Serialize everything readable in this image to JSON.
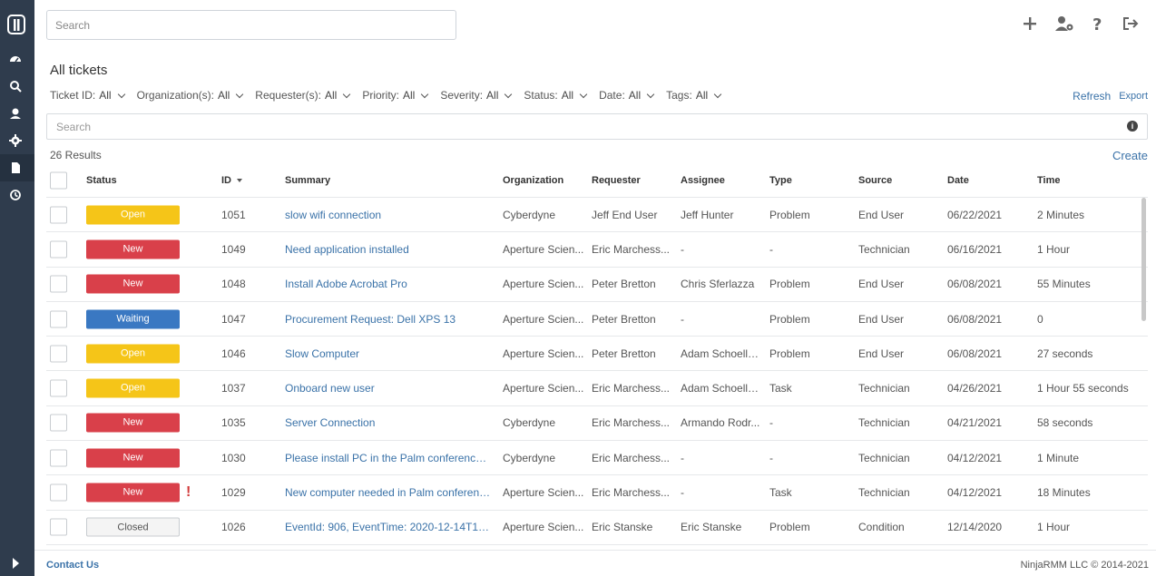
{
  "search": {
    "placeholder": "Search"
  },
  "page": {
    "title": "All tickets"
  },
  "filters": [
    {
      "label": "Ticket ID:",
      "value": "All"
    },
    {
      "label": "Organization(s):",
      "value": "All"
    },
    {
      "label": "Requester(s):",
      "value": "All"
    },
    {
      "label": "Priority:",
      "value": "All"
    },
    {
      "label": "Severity:",
      "value": "All"
    },
    {
      "label": "Status:",
      "value": "All"
    },
    {
      "label": "Date:",
      "value": "All"
    },
    {
      "label": "Tags:",
      "value": "All"
    }
  ],
  "actions": {
    "refresh": "Refresh",
    "export": "Export",
    "create": "Create"
  },
  "filter_search": {
    "placeholder": "Search"
  },
  "results_count": "26 Results",
  "columns": {
    "status": "Status",
    "id": "ID",
    "summary": "Summary",
    "organization": "Organization",
    "requester": "Requester",
    "assignee": "Assignee",
    "type": "Type",
    "source": "Source",
    "date": "Date",
    "time": "Time"
  },
  "status_colors": {
    "Open": "#f5c518",
    "New": "#d9404a",
    "Waiting": "#3a78c2",
    "Closed": "#f4f4f4"
  },
  "tickets": [
    {
      "status": "Open",
      "id": "1051",
      "summary": "slow wifi connection",
      "organization": "Cyberdyne",
      "requester": "Jeff End User",
      "assignee": "Jeff Hunter",
      "type": "Problem",
      "source": "End User",
      "date": "06/22/2021",
      "time": "2 Minutes",
      "alert": ""
    },
    {
      "status": "New",
      "id": "1049",
      "summary": "Need application installed",
      "organization": "Aperture Scien...",
      "requester": "Eric Marchess...",
      "assignee": "-",
      "type": "-",
      "source": "Technician",
      "date": "06/16/2021",
      "time": "1 Hour",
      "alert": ""
    },
    {
      "status": "New",
      "id": "1048",
      "summary": "Install Adobe Acrobat Pro",
      "organization": "Aperture Scien...",
      "requester": "Peter Bretton",
      "assignee": "Chris Sferlazza",
      "type": "Problem",
      "source": "End User",
      "date": "06/08/2021",
      "time": "55 Minutes",
      "alert": ""
    },
    {
      "status": "Waiting",
      "id": "1047",
      "summary": "Procurement Request: Dell XPS 13",
      "organization": "Aperture Scien...",
      "requester": "Peter Bretton",
      "assignee": "-",
      "type": "Problem",
      "source": "End User",
      "date": "06/08/2021",
      "time": "0",
      "alert": ""
    },
    {
      "status": "Open",
      "id": "1046",
      "summary": "Slow Computer",
      "organization": "Aperture Scien...",
      "requester": "Peter Bretton",
      "assignee": "Adam Schoelln...",
      "type": "Problem",
      "source": "End User",
      "date": "06/08/2021",
      "time": "27 seconds",
      "alert": ""
    },
    {
      "status": "Open",
      "id": "1037",
      "summary": "Onboard new user",
      "organization": "Aperture Scien...",
      "requester": "Eric Marchess...",
      "assignee": "Adam Schoelln...",
      "type": "Task",
      "source": "Technician",
      "date": "04/26/2021",
      "time": "1 Hour 55 seconds",
      "alert": ""
    },
    {
      "status": "New",
      "id": "1035",
      "summary": "Server Connection",
      "organization": "Cyberdyne",
      "requester": "Eric Marchess...",
      "assignee": "Armando Rodr...",
      "type": "-",
      "source": "Technician",
      "date": "04/21/2021",
      "time": "58 seconds",
      "alert": ""
    },
    {
      "status": "New",
      "id": "1030",
      "summary": "Please install PC in the Palm conference r...",
      "organization": "Cyberdyne",
      "requester": "Eric Marchess...",
      "assignee": "-",
      "type": "-",
      "source": "Technician",
      "date": "04/12/2021",
      "time": "1 Minute",
      "alert": ""
    },
    {
      "status": "New",
      "id": "1029",
      "summary": "New computer needed in Palm conferenc...",
      "organization": "Aperture Scien...",
      "requester": "Eric Marchess...",
      "assignee": "-",
      "type": "Task",
      "source": "Technician",
      "date": "04/12/2021",
      "time": "18 Minutes",
      "alert": "!"
    },
    {
      "status": "Closed",
      "id": "1026",
      "summary": "EventId: 906, EventTime: 2020-12-14T19:0...",
      "organization": "Aperture Scien...",
      "requester": "Eric Stanske",
      "assignee": "Eric Stanske",
      "type": "Problem",
      "source": "Condition",
      "date": "12/14/2020",
      "time": "1 Hour",
      "alert": ""
    }
  ],
  "footer": {
    "contact": "Contact Us",
    "copyright": "NinjaRMM LLC © 2014-2021"
  }
}
